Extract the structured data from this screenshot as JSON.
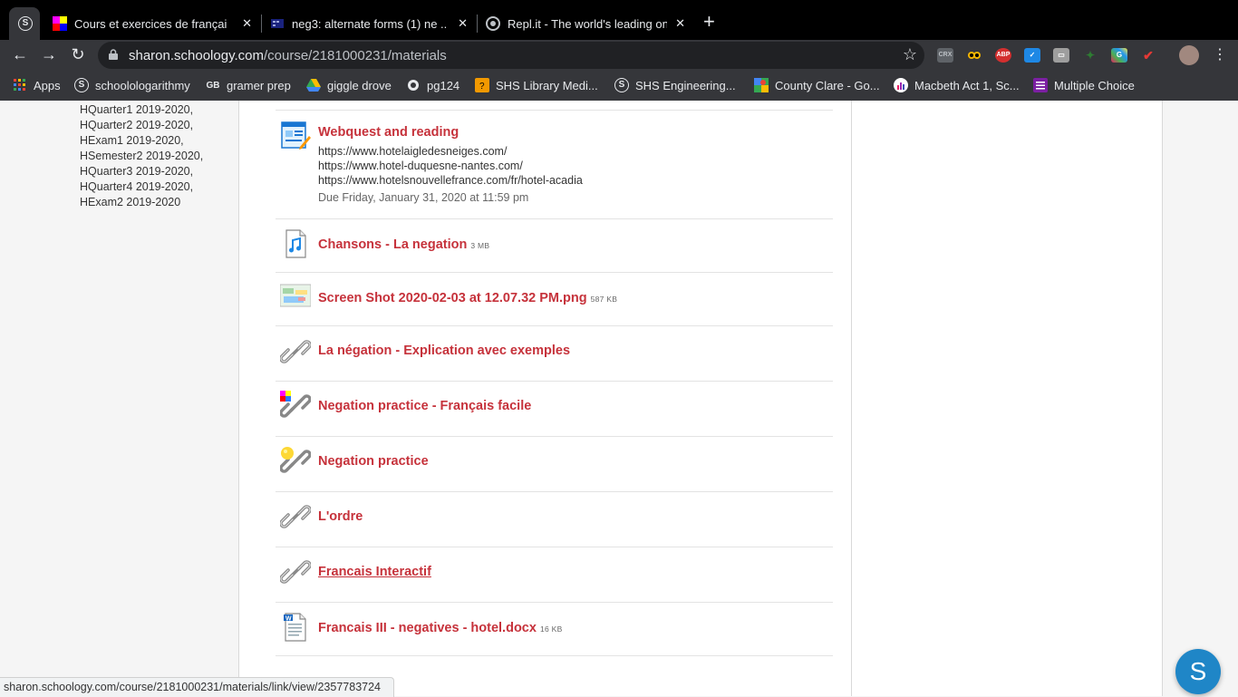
{
  "browser": {
    "tabs": [
      {
        "title": "Cours et exercices de françai"
      },
      {
        "title": "neg3: alternate forms (1) ne ..."
      },
      {
        "title": "Repl.it - The world's leading on"
      }
    ],
    "url_host": "sharon.schoology.com",
    "url_path": "/course/2181000231/materials",
    "extensions": [
      "CRX",
      "ABP"
    ],
    "bookmarks": [
      "Apps",
      "schoolologarithmy",
      "gramer prep",
      "giggle drove",
      "pg124",
      "SHS Library Medi...",
      "SHS Engineering...",
      "County Clare - Go...",
      "Macbeth Act 1, Sc...",
      "Multiple Choice"
    ]
  },
  "sidebar": {
    "grading_periods": [
      "HQuarter1 2019-2020,",
      "HQuarter2 2019-2020,",
      "HExam1 2019-2020,",
      "HSemester2 2019-2020,",
      "HQuarter3 2019-2020,",
      "HQuarter4 2019-2020,",
      "HExam2 2019-2020"
    ]
  },
  "materials": [
    {
      "title": "Webquest and reading",
      "icon": "assignment-icon",
      "desc": [
        "https://www.hotelaigledesneiges.com/",
        "https://www.hotel-duquesne-nantes.com/",
        "https://www.hotelsnouvellefrance.com/fr/hotel-acadia"
      ],
      "due": "Due Friday, January 31, 2020 at 11:59 pm"
    },
    {
      "title": "Chansons - La negation",
      "size": "3 MB",
      "icon": "audio-file-icon"
    },
    {
      "title": "Screen Shot 2020-02-03 at 12.07.32 PM.png",
      "size": "587 KB",
      "icon": "image-thumbnail-icon"
    },
    {
      "title": "La négation - Explication avec exemples",
      "icon": "link-icon"
    },
    {
      "title": "Negation practice - Français facile",
      "icon": "link-icon"
    },
    {
      "title": "Negation practice",
      "icon": "link-icon"
    },
    {
      "title": "L'ordre",
      "icon": "link-icon"
    },
    {
      "title": "Francais Interactif",
      "icon": "link-icon"
    },
    {
      "title": "Francais III - negatives - hotel.docx",
      "size": "16 KB",
      "icon": "word-doc-icon"
    }
  ],
  "status_url": "sharon.schoology.com/course/2181000231/materials/link/view/2357783724",
  "fab_label": "S",
  "colors": {
    "link": "#c6323b",
    "fab": "#1f86c7"
  }
}
